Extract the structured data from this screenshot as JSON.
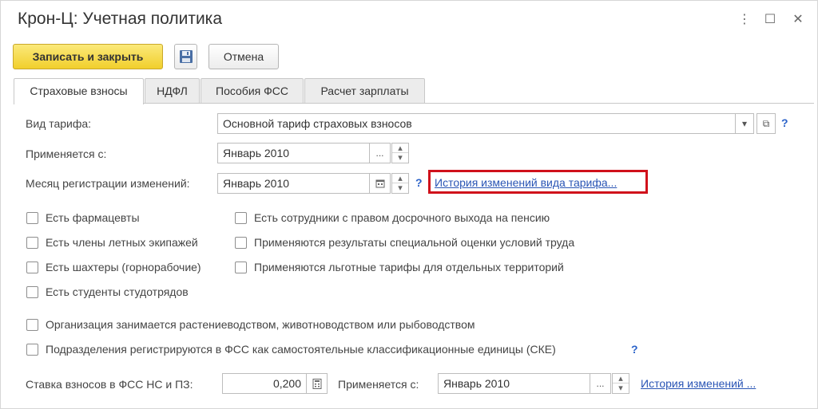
{
  "window": {
    "title": "Крон-Ц: Учетная политика",
    "more_glyph": "⋮",
    "maximize_glyph": "☐",
    "close_glyph": "✕"
  },
  "toolbar": {
    "save_close_label": "Записать и закрыть",
    "save_icon": "floppy-disk-icon",
    "cancel_label": "Отмена"
  },
  "tabs": [
    {
      "label": "Страховые взносы",
      "active": true
    },
    {
      "label": "НДФЛ",
      "active": false
    },
    {
      "label": "Пособия ФСС",
      "active": false
    },
    {
      "label": "Расчет зарплаты",
      "active": false
    }
  ],
  "form": {
    "tariff_label": "Вид тарифа:",
    "tariff_value": "Основной тариф страховых взносов",
    "applies_from_label": "Применяется с:",
    "applies_from_value": "Январь 2010",
    "reg_month_label": "Месяц регистрации изменений:",
    "reg_month_value": "Январь 2010",
    "history_tariff_link": "История изменений вида тарифа...",
    "help_glyph": "?",
    "ellipsis_glyph": "...",
    "dropdown_glyph": "▾",
    "open_glyph": "⧉",
    "spin_up": "▴",
    "spin_down": "▾"
  },
  "checkboxes_left": [
    {
      "label": "Есть фармацевты",
      "checked": false
    },
    {
      "label": "Есть члены летных экипажей",
      "checked": false
    },
    {
      "label": "Есть шахтеры (горнорабочие)",
      "checked": false
    },
    {
      "label": "Есть студенты студотрядов",
      "checked": false
    }
  ],
  "checkboxes_right": [
    {
      "label": "Есть сотрудники с правом досрочного выхода на пенсию",
      "checked": false
    },
    {
      "label": "Применяются результаты специальной оценки условий труда",
      "checked": false
    },
    {
      "label": "Применяются льготные тарифы для отдельных территорий",
      "checked": false
    }
  ],
  "checkboxes_bottom": [
    {
      "label": "Организация занимается растениеводством, животноводством или рыбоводством",
      "checked": false
    },
    {
      "label": "Подразделения регистрируются в ФСС как самостоятельные классификационные единицы (СКЕ)",
      "checked": false
    }
  ],
  "fss": {
    "rate_label": "Ставка взносов в ФСС НС и ПЗ:",
    "rate_value": "0,200",
    "applies_from_label": "Применяется с:",
    "applies_from_value": "Январь 2010",
    "history_link": "История изменений ..."
  },
  "colors": {
    "primary_button": "#f1cf2c",
    "link": "#2a55b5",
    "highlight_frame": "#d0111b"
  }
}
